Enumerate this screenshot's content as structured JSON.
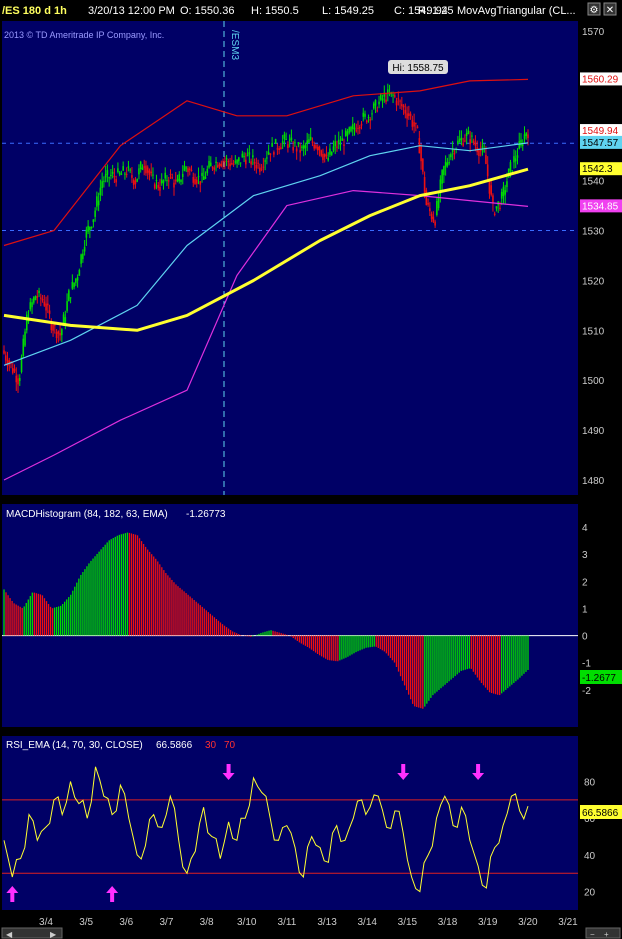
{
  "header": {
    "symbol": "/ES 180 d 1h",
    "datetime": "3/20/13 12:00 PM",
    "open": "O: 1550.36",
    "high": "H: 1550.5",
    "low": "L: 1549.25",
    "close": "C: 1549.94",
    "range": "R: 1.25",
    "study": "MovAvgTriangular (CL..."
  },
  "copyright": "2013 © TD Ameritrade IP Company, Inc.",
  "contract_marker": "/ESM3",
  "hi_label": "Hi: 1558.75",
  "price_tags": [
    {
      "text": "1560.29",
      "value": 1560.29,
      "bg": "#ffffff",
      "fg": "#e01010"
    },
    {
      "text": "1549.94",
      "value": 1549.94,
      "bg": "#ffffff",
      "fg": "#e01010"
    },
    {
      "text": "1547.57",
      "value": 1547.57,
      "bg": "#5fd3f0",
      "fg": "#000000"
    },
    {
      "text": "1542.3",
      "value": 1542.3,
      "bg": "#ffff30",
      "fg": "#000000"
    },
    {
      "text": "1534.85",
      "value": 1534.85,
      "bg": "#f040f0",
      "fg": "#ffffff"
    }
  ],
  "macd": {
    "title": "MACDHistogram (84, 182, 63, EMA)",
    "value": "-1.26773",
    "tag": "-1.2677"
  },
  "rsi": {
    "title": "RSI_EMA (14, 70, 30, CLOSE)",
    "value": "66.5866",
    "ob": "30",
    "os": "70",
    "tag": "66.5866"
  },
  "colors": {
    "background": "#000066",
    "up_bar": "#00dd00",
    "down_bar": "#ee1010",
    "triangular_ma": "#ffff30",
    "mid_ma": "#5fd3f0",
    "upper_band": "#dd1010",
    "lower_band": "#dd30dd",
    "rsi_line": "#ffff30",
    "arrow": "#ff30ff"
  },
  "chart_data": [
    {
      "type": "candlestick",
      "title": "/ES 180 d 1h",
      "ylim": [
        1477,
        1572
      ],
      "y_ticks": [
        1480,
        1490,
        1500,
        1510,
        1520,
        1530,
        1540,
        1550,
        1560,
        1570
      ],
      "x_ticks": [
        "3/4",
        "3/5",
        "3/6",
        "3/7",
        "3/8",
        "3/10",
        "3/11",
        "3/13",
        "3/14",
        "3/15",
        "3/18",
        "3/19",
        "3/20",
        "3/21"
      ],
      "price_path": [
        [
          0,
          1506
        ],
        [
          1,
          1503
        ],
        [
          2,
          1500
        ],
        [
          3,
          1513
        ],
        [
          4,
          1517
        ],
        [
          5,
          1516
        ],
        [
          6,
          1511
        ],
        [
          7,
          1509
        ],
        [
          8,
          1517
        ],
        [
          9,
          1521
        ],
        [
          10,
          1529
        ],
        [
          11,
          1533
        ],
        [
          12,
          1540
        ],
        [
          13,
          1541
        ],
        [
          14,
          1541
        ],
        [
          15,
          1542
        ],
        [
          16,
          1540
        ],
        [
          17,
          1544
        ],
        [
          18,
          1540
        ],
        [
          19,
          1539
        ],
        [
          20,
          1541
        ],
        [
          21,
          1539
        ],
        [
          22,
          1543
        ],
        [
          23,
          1541
        ],
        [
          24,
          1540
        ],
        [
          25,
          1543
        ],
        [
          26,
          1544
        ],
        [
          27,
          1544
        ],
        [
          28,
          1543
        ],
        [
          29,
          1545
        ],
        [
          30,
          1544
        ],
        [
          31,
          1543
        ],
        [
          32,
          1546
        ],
        [
          33,
          1547
        ],
        [
          34,
          1548
        ],
        [
          35,
          1547
        ],
        [
          36,
          1546
        ],
        [
          37,
          1548
        ],
        [
          38,
          1547
        ],
        [
          39,
          1544
        ],
        [
          40,
          1547
        ],
        [
          41,
          1548
        ],
        [
          42,
          1550
        ],
        [
          43,
          1552
        ],
        [
          44,
          1553
        ],
        [
          45,
          1555
        ],
        [
          46,
          1557
        ],
        [
          47,
          1557
        ],
        [
          48,
          1555
        ],
        [
          49,
          1553
        ],
        [
          50,
          1549
        ],
        [
          51,
          1535
        ],
        [
          52,
          1532
        ],
        [
          53,
          1542
        ],
        [
          54,
          1546
        ],
        [
          55,
          1548
        ],
        [
          56,
          1549
        ],
        [
          57,
          1547
        ],
        [
          58,
          1545
        ],
        [
          59,
          1534
        ],
        [
          60,
          1536
        ],
        [
          61,
          1542
        ],
        [
          62,
          1546
        ],
        [
          63,
          1550
        ]
      ],
      "bars_high_low": [
        [
          1500,
          1558.75
        ]
      ],
      "triangular_ma": [
        [
          0,
          1513
        ],
        [
          8,
          1511
        ],
        [
          16,
          1510
        ],
        [
          22,
          1513
        ],
        [
          30,
          1520
        ],
        [
          38,
          1528
        ],
        [
          44,
          1533
        ],
        [
          50,
          1537
        ],
        [
          56,
          1539
        ],
        [
          63,
          1542.3
        ]
      ],
      "mid_ma": [
        [
          0,
          1503
        ],
        [
          8,
          1508
        ],
        [
          16,
          1515
        ],
        [
          22,
          1527
        ],
        [
          30,
          1537
        ],
        [
          38,
          1541
        ],
        [
          44,
          1545
        ],
        [
          50,
          1547
        ],
        [
          56,
          1546
        ],
        [
          63,
          1547.57
        ]
      ],
      "upper_band": [
        [
          0,
          1527
        ],
        [
          6,
          1530
        ],
        [
          14,
          1547
        ],
        [
          22,
          1556
        ],
        [
          28,
          1553
        ],
        [
          34,
          1553
        ],
        [
          42,
          1557
        ],
        [
          50,
          1558
        ],
        [
          56,
          1560
        ],
        [
          63,
          1560.29
        ]
      ],
      "lower_band": [
        [
          0,
          1480
        ],
        [
          6,
          1485
        ],
        [
          14,
          1492
        ],
        [
          22,
          1498
        ],
        [
          28,
          1521
        ],
        [
          34,
          1535
        ],
        [
          42,
          1538
        ],
        [
          50,
          1537
        ],
        [
          56,
          1536
        ],
        [
          63,
          1534.85
        ]
      ]
    },
    {
      "type": "bar",
      "title": "MACDHistogram (84, 182, 63, EMA)",
      "ylim": [
        -3,
        4
      ],
      "y_ticks": [
        -2,
        -1,
        0,
        1,
        2,
        3,
        4
      ],
      "values": [
        1.7,
        1.2,
        1.0,
        1.6,
        1.5,
        1.0,
        1.1,
        1.5,
        2.2,
        2.7,
        3.1,
        3.5,
        3.7,
        3.8,
        3.7,
        3.2,
        2.8,
        2.3,
        1.9,
        1.6,
        1.3,
        1.0,
        0.7,
        0.4,
        0.15,
        0.0,
        -0.05,
        0.1,
        0.2,
        0.1,
        0.0,
        -0.25,
        -0.45,
        -0.7,
        -0.9,
        -0.95,
        -0.8,
        -0.6,
        -0.45,
        -0.4,
        -0.6,
        -1.0,
        -1.8,
        -2.6,
        -2.7,
        -2.2,
        -1.9,
        -1.6,
        -1.3,
        -1.2,
        -1.7,
        -2.1,
        -2.2,
        -1.9,
        -1.6,
        -1.26773
      ]
    },
    {
      "type": "line",
      "title": "RSI_EMA (14, 70, 30, CLOSE)",
      "ylim": [
        10,
        95
      ],
      "y_ticks": [
        20,
        40,
        60,
        80
      ],
      "levels": [
        30,
        70
      ],
      "values": [
        48,
        28,
        38,
        62,
        48,
        55,
        70,
        62,
        80,
        68,
        60,
        88,
        72,
        62,
        78,
        60,
        40,
        45,
        62,
        55,
        72,
        48,
        30,
        42,
        66,
        50,
        38,
        58,
        48,
        60,
        82,
        74,
        60,
        48,
        56,
        44,
        28,
        50,
        44,
        36,
        56,
        48,
        60,
        70,
        66,
        72,
        55,
        64,
        52,
        28,
        20,
        40,
        60,
        72,
        56,
        66,
        48,
        34,
        22,
        44,
        56,
        72,
        64,
        66.5866
      ],
      "arrows_up_at": [
        1,
        13
      ],
      "arrows_down_at": [
        27,
        48,
        57
      ]
    }
  ]
}
